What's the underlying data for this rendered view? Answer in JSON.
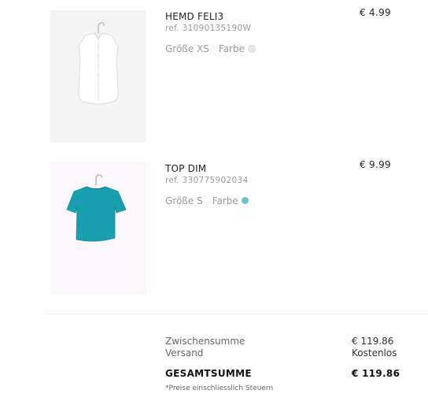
{
  "items": [
    {
      "name": "HEMD FELI3",
      "ref": "ref. 31090135190W",
      "size_label": "Größe XS",
      "color_label": "Farbe",
      "color_hex": "#ece9e2",
      "price": "€ 4.99",
      "image_icon": "white-shirt-icon"
    },
    {
      "name": "TOP DIM",
      "ref": "ref. 330775902034",
      "size_label": "Größe S",
      "color_label": "Farbe",
      "color_hex": "#6fc2c8",
      "price": "€ 9.99",
      "image_icon": "teal-top-icon"
    }
  ],
  "summary": {
    "subtotal_label": "Zwischensumme",
    "subtotal_value": "€ 119.86",
    "shipping_label": "Versand",
    "shipping_value": "Kostenlos",
    "total_label": "GESAMTSUMME",
    "total_value": "€ 119.86",
    "note": "*Preise einschliesslich Steuern"
  }
}
